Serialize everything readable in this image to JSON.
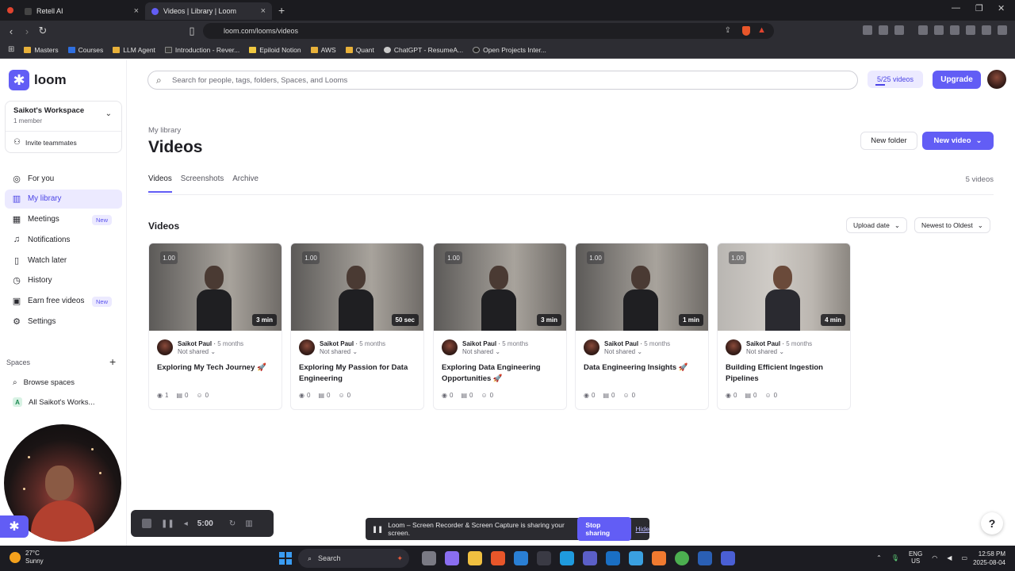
{
  "browser": {
    "tabs": [
      {
        "title": "Retell AI",
        "active": false
      },
      {
        "title": "Videos | Library | Loom",
        "active": true
      }
    ],
    "url": "loom.com/looms/videos",
    "bookmarks": [
      "Masters",
      "Courses",
      "LLM Agent",
      "Introduction - Rever...",
      "Epiloid Notion",
      "AWS",
      "Quant",
      "ChatGPT - ResumeA...",
      "Open Projects Inter..."
    ]
  },
  "sidebar": {
    "brand": "loom",
    "workspace_name": "Saikot's Workspace",
    "workspace_members": "1 member",
    "invite_label": "Invite teammates",
    "nav": [
      {
        "label": "For you",
        "icon": "user-circle-icon",
        "active": false,
        "badge": ""
      },
      {
        "label": "My library",
        "icon": "library-icon",
        "active": true,
        "badge": ""
      },
      {
        "label": "Meetings",
        "icon": "calendar-icon",
        "active": false,
        "badge": "New"
      },
      {
        "label": "Notifications",
        "icon": "bell-icon",
        "active": false,
        "badge": ""
      },
      {
        "label": "Watch later",
        "icon": "bookmark-icon",
        "active": false,
        "badge": ""
      },
      {
        "label": "History",
        "icon": "clock-icon",
        "active": false,
        "badge": ""
      },
      {
        "label": "Earn free videos",
        "icon": "gift-icon",
        "active": false,
        "badge": "New"
      },
      {
        "label": "Settings",
        "icon": "gear-icon",
        "active": false,
        "badge": ""
      }
    ],
    "spaces_heading": "Spaces",
    "browse_spaces": "Browse spaces",
    "all_spaces": "All Saikot's Works...",
    "all_spaces_letter": "A"
  },
  "header": {
    "search_placeholder": "Search for people, tags, folders, Spaces, and Looms",
    "quota": "5/25 videos",
    "upgrade": "Upgrade"
  },
  "page": {
    "breadcrumb": "My library",
    "title": "Videos",
    "new_folder": "New folder",
    "new_video": "New video",
    "tabs": [
      {
        "label": "Videos",
        "active": true
      },
      {
        "label": "Screenshots",
        "active": false
      },
      {
        "label": "Archive",
        "active": false
      }
    ],
    "count": "5 videos",
    "section": "Videos",
    "sort_field": "Upload date",
    "sort_order": "Newest to Oldest"
  },
  "videos": [
    {
      "title": "Exploring My Tech Journey 🚀",
      "duration": "3 min",
      "speed": "1.00",
      "owner": "Saikot Paul",
      "ago": "5 months",
      "sharing": "Not shared",
      "views": "1",
      "comments": "0",
      "reactions": "0",
      "thumb": "dark"
    },
    {
      "title": "Exploring My Passion for Data Engineering",
      "duration": "50 sec",
      "speed": "1.00",
      "owner": "Saikot Paul",
      "ago": "5 months",
      "sharing": "Not shared",
      "views": "0",
      "comments": "0",
      "reactions": "0",
      "thumb": "dark"
    },
    {
      "title": "Exploring Data Engineering Opportunities 🚀",
      "duration": "3 min",
      "speed": "1.00",
      "owner": "Saikot Paul",
      "ago": "5 months",
      "sharing": "Not shared",
      "views": "0",
      "comments": "0",
      "reactions": "0",
      "thumb": "dark"
    },
    {
      "title": "Data Engineering Insights 🚀",
      "duration": "1 min",
      "speed": "1.00",
      "owner": "Saikot Paul",
      "ago": "5 months",
      "sharing": "Not shared",
      "views": "0",
      "comments": "0",
      "reactions": "0",
      "thumb": "dark"
    },
    {
      "title": "Building Efficient Ingestion Pipelines",
      "duration": "4 min",
      "speed": "1.00",
      "owner": "Saikot Paul",
      "ago": "5 months",
      "sharing": "Not shared",
      "views": "0",
      "comments": "0",
      "reactions": "0",
      "thumb": "light"
    }
  ],
  "recorder": {
    "time": "5:00"
  },
  "share_notice": {
    "text": "Loom – Screen Recorder & Screen Capture is sharing your screen.",
    "stop": "Stop sharing",
    "hide": "Hide"
  },
  "taskbar": {
    "temp": "27°C",
    "weather": "Sunny",
    "search": "Search",
    "lang": "ENG",
    "region": "US",
    "time": "12:58 PM",
    "date": "2025-08-04"
  },
  "colors": {
    "accent": "#625df5",
    "accent_soft": "#eceaff"
  }
}
